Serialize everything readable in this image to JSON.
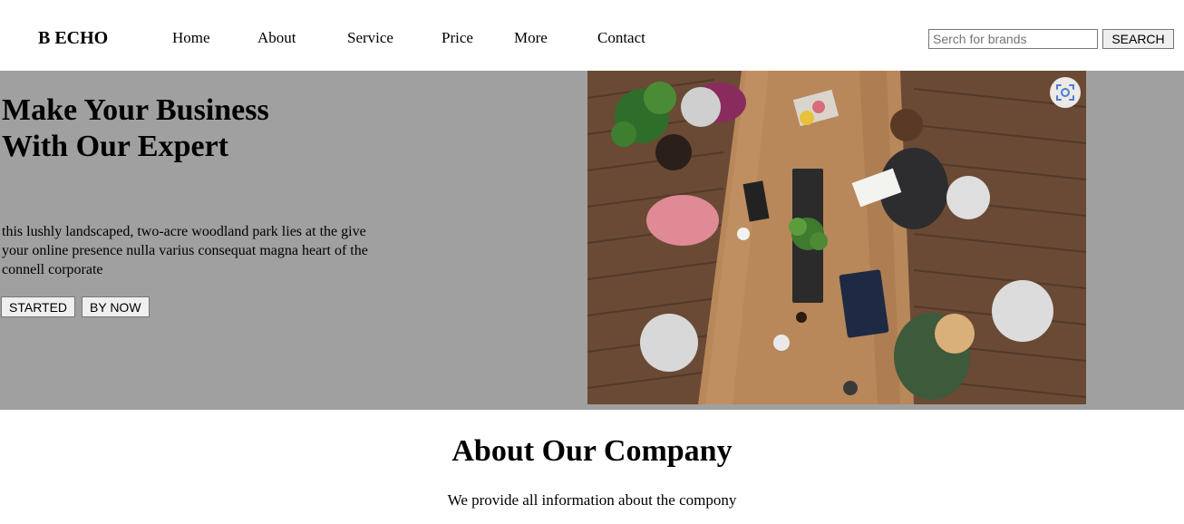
{
  "header": {
    "brand": "B ECHO",
    "nav": [
      "Home",
      "About",
      "Service",
      "Price",
      "More",
      "Contact"
    ],
    "search": {
      "placeholder": "Serch for brands",
      "value": "",
      "button_label": "SEARCH"
    }
  },
  "hero": {
    "title": "Make Your Business With Our Expert",
    "text": "this lushly landscaped, two-acre woodland park lies at the give your online presence nulla varius consequat magna heart of the connell corporate",
    "buttons": [
      "STARTED",
      "BY NOW"
    ],
    "image_icon": "visual-search-icon"
  },
  "about": {
    "title": "About Our Company",
    "subtitle": "We provide all information about the compony"
  },
  "colors": {
    "hero_background": "#a0a0a0",
    "page_background": "#ffffff",
    "lens_icon": "#4a7fcf"
  }
}
